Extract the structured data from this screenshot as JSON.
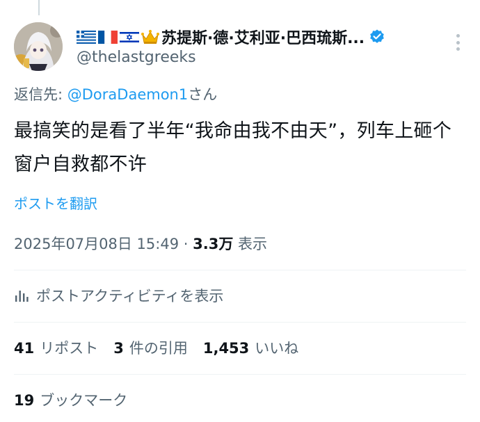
{
  "author": {
    "flags": [
      "greece-flag-icon",
      "france-flag-icon",
      "israel-flag-icon",
      "crown-icon"
    ],
    "display_name": "苏提斯·德·艾利亚·巴西琉斯...",
    "handle": "@thelastgreeks",
    "verified_color": "#1d9bf0"
  },
  "reply": {
    "prefix": "返信先: ",
    "mention": "@DoraDaemon1",
    "suffix": "さん"
  },
  "tweet": {
    "text": "最搞笑的是看了半年“我命由我不由天”，列车上砸个窗户自救都不许",
    "translate_label": "ポストを翻訳"
  },
  "meta": {
    "datetime": "2025年07月08日 15:49",
    "separator": " · ",
    "views_count": "3.3万",
    "views_label": " 表示"
  },
  "activity": {
    "label": "ポストアクティビティを表示"
  },
  "stats": {
    "reposts_count": "41",
    "reposts_label": "リポスト",
    "quotes_count": "3",
    "quotes_label": "件の引用",
    "likes_count": "1,453",
    "likes_label": "いいね",
    "bookmarks_count": "19",
    "bookmarks_label": "ブックマーク"
  },
  "colors": {
    "link": "#1d9bf0",
    "secondary_text": "#536471",
    "primary_text": "#0f1419",
    "divider": "#eff3f4"
  }
}
